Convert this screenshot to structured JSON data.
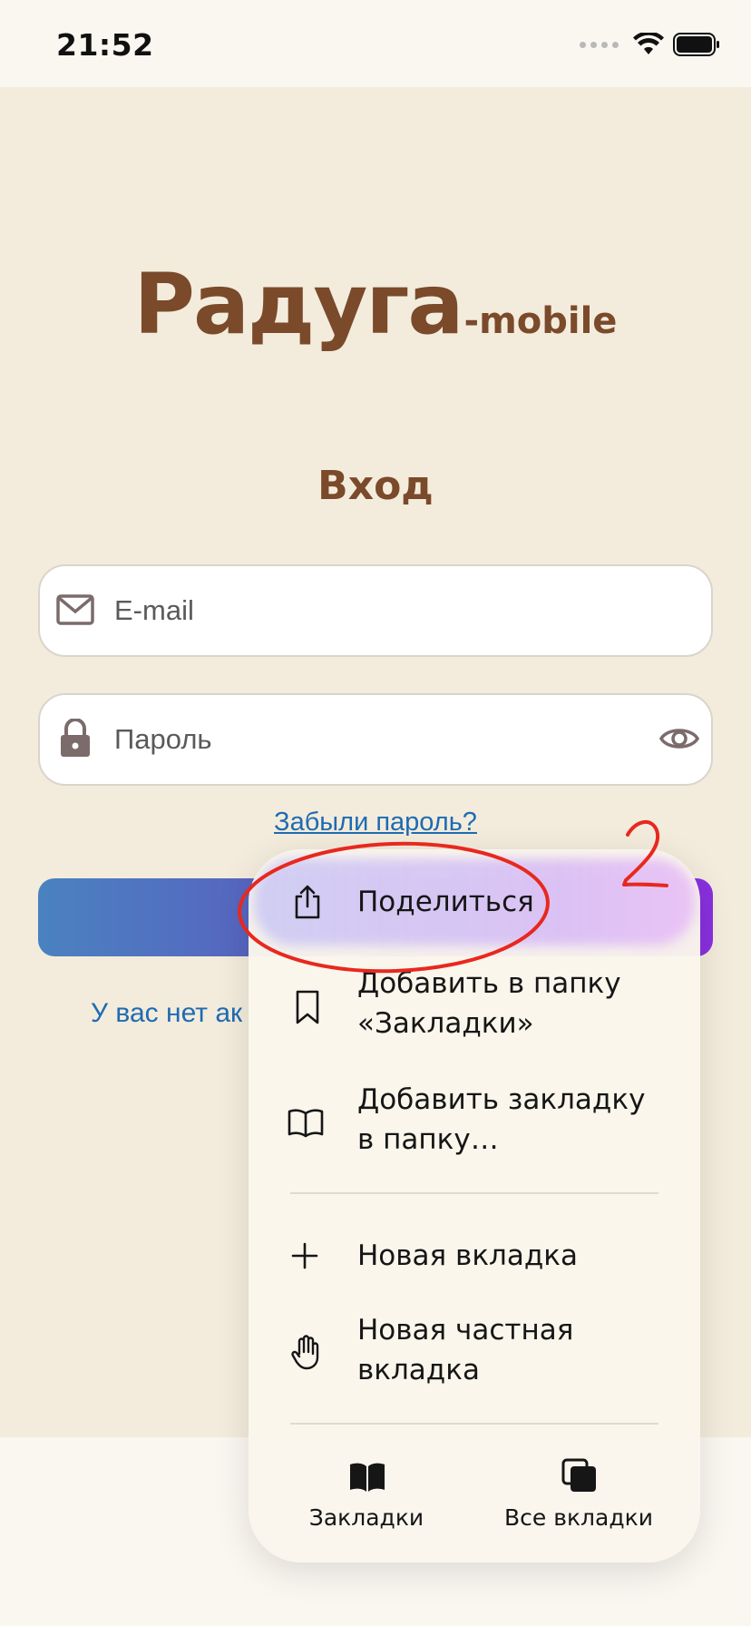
{
  "status_bar": {
    "time": "21:52",
    "icons": [
      "signal-icon",
      "wifi-icon",
      "battery-icon"
    ]
  },
  "logo": {
    "main": "Радуга",
    "suffix": "-mobile",
    "color": "#7a4a2b"
  },
  "login": {
    "title": "Вход",
    "email_placeholder": "E-mail",
    "password_placeholder": "Пароль",
    "forgot_link": "Забыли пароль?",
    "register_text_visible": "У вас нет ак"
  },
  "context_menu": {
    "items": [
      {
        "label": "Поделиться",
        "icon": "share-icon"
      },
      {
        "label": "Добавить в папку «Закладки»",
        "icon": "bookmark-icon"
      },
      {
        "label": "Добавить закладку в папку…",
        "icon": "book-open-icon"
      },
      {
        "label": "Новая вкладка",
        "icon": "plus-icon"
      },
      {
        "label": "Новая частная вкладка",
        "icon": "hand-icon"
      }
    ],
    "bottom_buttons": [
      {
        "label": "Закладки",
        "icon": "bookmarks-icon"
      },
      {
        "label": "Все вкладки",
        "icon": "all-tabs-icon"
      }
    ]
  },
  "annotation": {
    "number": "2",
    "color": "#e8281e"
  },
  "colors": {
    "background": "#f3ecdc",
    "link": "#1f6bb3",
    "button_gradient_start": "#4a82c0",
    "button_gradient_end": "#8a2fe0"
  }
}
